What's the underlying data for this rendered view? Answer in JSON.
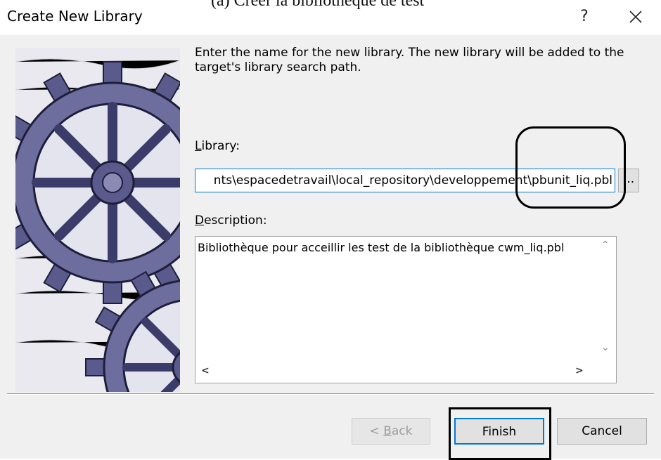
{
  "caption": "(a) Créer la bibliothèque de test",
  "window": {
    "title": "Create New Library",
    "help_label": "?",
    "close_icon": "close-icon"
  },
  "instruction": "Enter the name for the new library.  The new library will be added to the target's library search path.",
  "library": {
    "label_key": "L",
    "label_rest": "ibrary:",
    "value": "nts\\espacedetravail\\local_repository\\developpement\\pbunit_liq.pbl",
    "browse_label": "..."
  },
  "description": {
    "label_key": "D",
    "label_rest": "escription:",
    "value": "Bibliothèque pour acceillir les test de la bibliothèque cwm_liq.pbl"
  },
  "buttons": {
    "back_prefix": "< ",
    "back_key": "B",
    "back_rest": "ack",
    "finish": "Finish",
    "cancel": "Cancel"
  },
  "colors": {
    "accent": "#0078d7",
    "panel": "#f0f0f0",
    "gear": "#5a5a8c"
  }
}
